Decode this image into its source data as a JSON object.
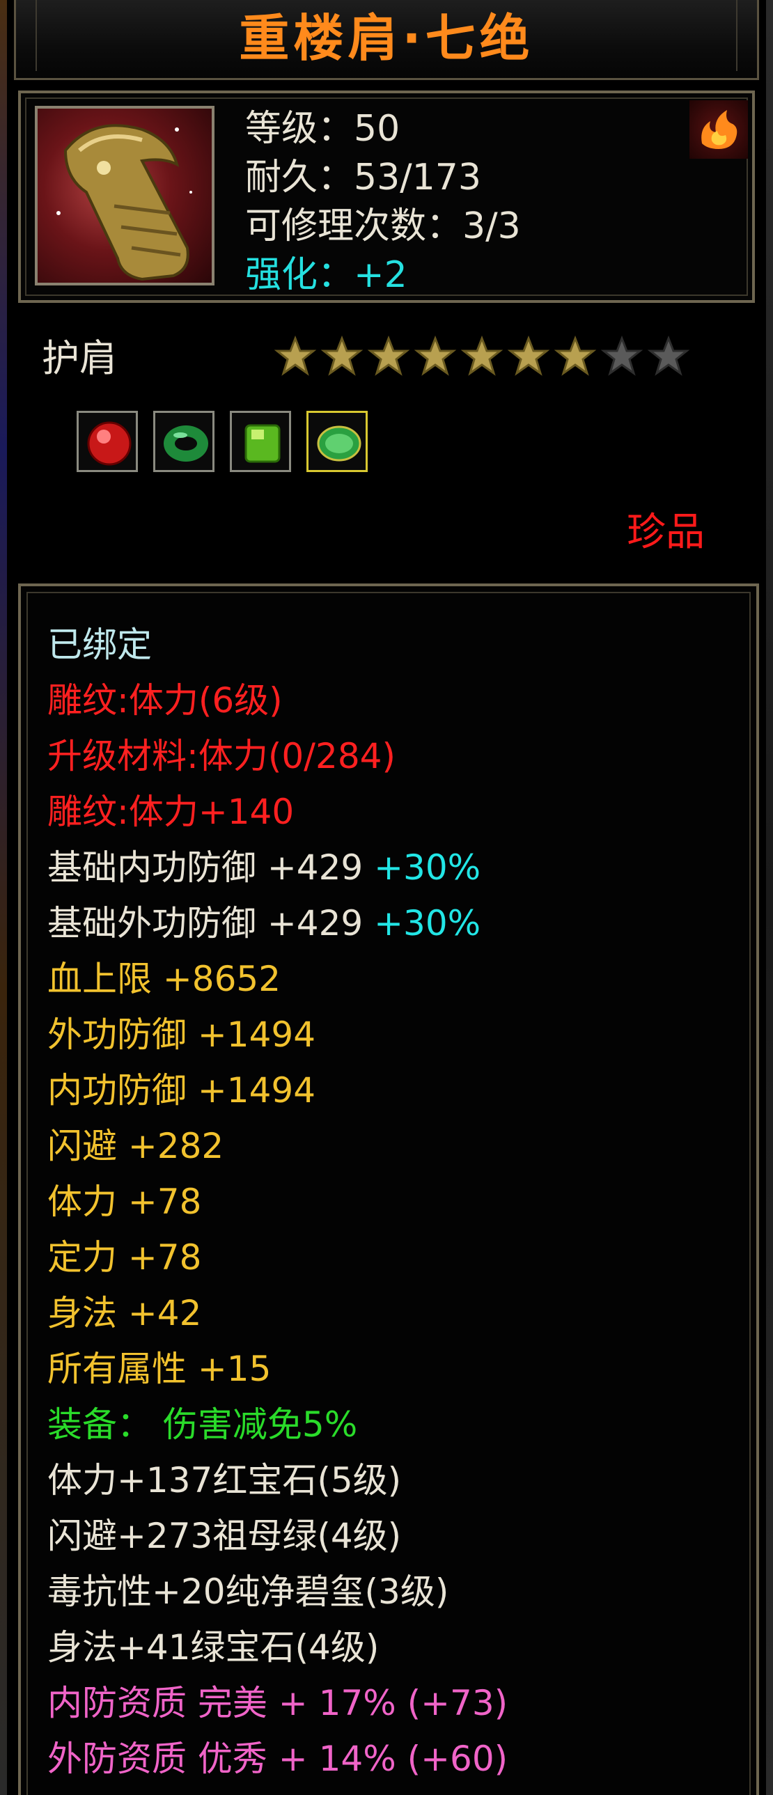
{
  "item": {
    "name": "重楼肩·七绝",
    "level": "等级：50",
    "durability": "耐久：53/173",
    "repair_count": "可修理次数：3/3",
    "enhance": "强化：+2",
    "type": "护肩",
    "stars": {
      "filled": 7,
      "total": 9
    },
    "gems": [
      "ruby-gem-icon",
      "jade-ring-icon",
      "green-gem-icon",
      "emerald-gem-icon"
    ],
    "rarity": "珍品"
  },
  "properties": {
    "bound": "已绑定",
    "engrave_level": "雕纹:体力(6级)",
    "upgrade_material": "升级材料:体力(0/284)",
    "engrave_bonus": "雕纹:体力+140",
    "base_inner_def": {
      "text": "基础内功防御 +429",
      "pct": "+30%"
    },
    "base_outer_def": {
      "text": "基础外功防御 +429",
      "pct": "+30%"
    },
    "hp_max": "血上限 +8652",
    "outer_def": "外功防御 +1494",
    "inner_def": "内功防御 +1494",
    "dodge": "闪避 +282",
    "stamina": "体力 +78",
    "focus": "定力 +78",
    "agility": "身法 +42",
    "all_attr": "所有属性 +15",
    "equip_effect": "装备： 伤害减免5%",
    "gem_lines": [
      "体力+137红宝石(5级)",
      "闪避+273祖母绿(4级)",
      "毒抗性+20纯净碧玺(3级)",
      "身法+41绿宝石(4级)"
    ],
    "inner_quality": "内防资质 完美 + 17% (+73)",
    "outer_quality": "外防资质 优秀 + 14% (+60)"
  },
  "colors": {
    "title": "#ff8a1c",
    "red": "#ff2020",
    "gold": "#f2c22e",
    "cyan": "#22e6e6",
    "green": "#2adc2a",
    "pink": "#f064c8"
  }
}
